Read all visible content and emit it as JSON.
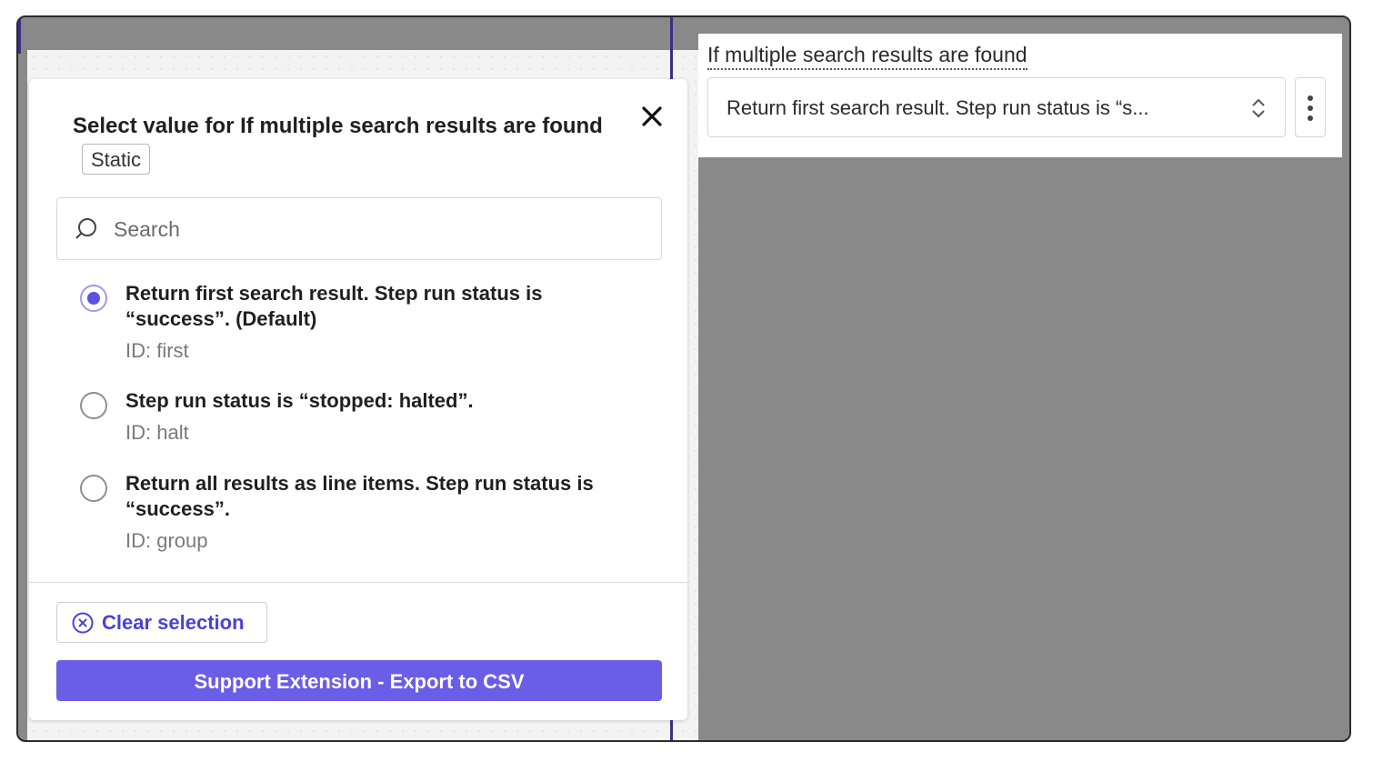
{
  "right_panel": {
    "field_label": "If multiple search results are found",
    "selected_value": "Return first search result. Step run status is “s..."
  },
  "popover": {
    "title": "Select value for If multiple search results are found",
    "badge": "Static",
    "search": {
      "placeholder": "Search",
      "value": ""
    },
    "options": [
      {
        "label": "Return first search result. Step run status is “success”. (Default)",
        "id_text": "ID: first",
        "selected": true
      },
      {
        "label": "Step run status is “stopped: halted”.",
        "id_text": "ID: halt",
        "selected": false
      },
      {
        "label": "Return all results as line items. Step run status is “success”.",
        "id_text": "ID: group",
        "selected": false
      }
    ],
    "clear_label": "Clear selection",
    "primary_label": "Support Extension - Export to CSV"
  },
  "colors": {
    "accent": "#6a5de6",
    "link": "#4a42d6",
    "overlay": "#898989"
  },
  "icons": [
    "close-icon",
    "search-icon",
    "clear-circle-x-icon",
    "chevron-updown-icon",
    "kebab-menu-icon"
  ]
}
